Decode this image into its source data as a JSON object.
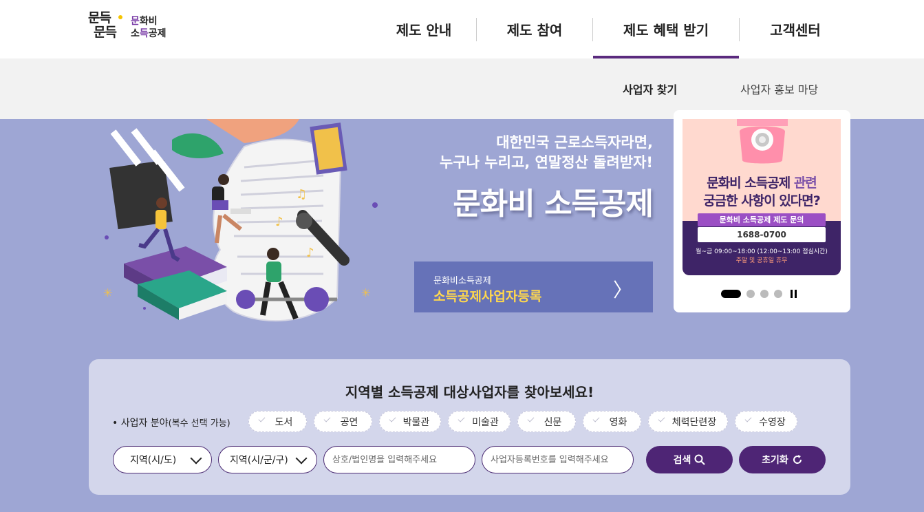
{
  "header": {
    "logo_mark_line1": "문득",
    "logo_mark_line2": "문득",
    "logo_name_line1_accent": "문",
    "logo_name_line1": "화비",
    "logo_name_line2_a": "소",
    "logo_name_line2_accent": "득",
    "logo_name_line2_b": "공제",
    "nav": [
      "제도 안내",
      "제도 참여",
      "제도 혜택 받기",
      "고객센터"
    ],
    "active_nav_index": 2
  },
  "subnav": {
    "items": [
      "사업자 찾기",
      "사업자 홍보 마당"
    ]
  },
  "hero": {
    "sub_line1": "대한민국 근로소득자라면,",
    "sub_line2": "누구나 누리고, 연말정산 돌려받자!",
    "title": "문화비 소득공제",
    "register": {
      "small": "문화비소득공제",
      "big": "소득공제사업자등록",
      "arrow": "〉"
    }
  },
  "banner": {
    "q_bold": "문화비 소득공제",
    "q_rest": " 관련",
    "q_line2": "궁금한 사항이 있다면?",
    "pill": "문화비 소득공제 제도 문의",
    "tel": "1688-0700",
    "hours": "월~금 09:00~18:00 (12:00~13:00 점심시간)",
    "holiday": "주말 및 공휴일 휴무",
    "slide_count": 4,
    "active_slide": 1
  },
  "search": {
    "title": "지역별 소득공제 대상사업자를 찾아보세요!",
    "field_label": "• 사업자 분야",
    "field_label_note": "(복수 선택 가능)",
    "categories": [
      "도서",
      "공연",
      "박물관",
      "미술관",
      "신문",
      "영화",
      "체력단련장",
      "수영장"
    ],
    "region_sido": "지역(시/도)",
    "region_sigungu": "지역(시/군/구)",
    "name_placeholder": "상호/법인명을 입력해주세요",
    "bizno_placeholder": "사업자등록번호를 입력해주세요",
    "search_label": "검색",
    "reset_label": "초기화"
  },
  "colors": {
    "brand_purple": "#4e2575",
    "hero_bg": "#9ea6d4",
    "register_bg": "#6672b8",
    "accent_yellow": "#ffd84d"
  },
  "icons": {
    "search": "magnifier-icon",
    "reset": "refresh-icon",
    "next": "chevron-right-icon"
  }
}
